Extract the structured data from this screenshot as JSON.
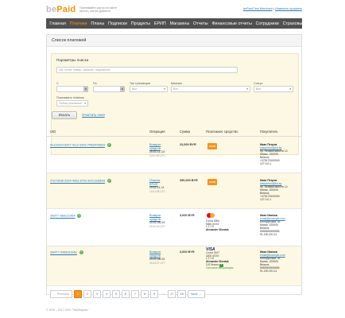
{
  "logo": {
    "be": "be",
    "paid": "Paid"
  },
  "tagline": [
    "Принимайте карты на сайте",
    "просто, как вы думаете"
  ],
  "user": {
    "merchant": "bePaid Test Merchant",
    "separator": " • ",
    "edit_profile": "Изменить профиль"
  },
  "nav": {
    "items": [
      {
        "label": "Главная",
        "active": false
      },
      {
        "label": "Платежи",
        "active": true
      },
      {
        "label": "Планы",
        "active": false
      },
      {
        "label": "Подписки",
        "active": false
      },
      {
        "label": "Продукты",
        "active": false
      },
      {
        "label": "ЕРИП",
        "active": false
      },
      {
        "label": "Магазины",
        "active": false
      },
      {
        "label": "Отчеты",
        "active": false
      },
      {
        "label": "Финансовые отчеты",
        "active": false
      },
      {
        "label": "Сотрудники",
        "active": false
      },
      {
        "label": "Страховые депозиты",
        "active": false
      }
    ]
  },
  "page": {
    "title": "Список платежей"
  },
  "filters": {
    "title": "Параметры поиска",
    "search_placeholder": "Uid, отчет, номер, магазин, покупатель",
    "from_label": "С",
    "to_label": "По",
    "type_label": "Тип транзакции",
    "shop_label": "Магазин",
    "status_label": "Статус",
    "show_label": "Показывать платежи",
    "type_value": "Все",
    "shop_value": "Все",
    "status_value": "Все",
    "show_value": "Только реальные",
    "calendar_glyph": "▦",
    "arrow_glyph": "▾",
    "search_button": "Искать",
    "clear_link": "Очистить поля"
  },
  "table": {
    "headers": {
      "uid": "UID",
      "operation": "Операция",
      "amount": "Сумма",
      "method": "Платежное средство",
      "buyer": "Покупатель"
    },
    "rows": [
      {
        "uid": "5e12e5e4-6d07-4cc2-a493-7f4b6448be5",
        "operation": [
          "Возврат",
          "средств"
        ],
        "date": "2015-11-13",
        "time": "13:02:59 UTC",
        "amount": "22,000 BYR",
        "method_type": "erip",
        "method_label": "ЕРИП",
        "buyer": [
          "Иван Петров",
          "ivanpetrov@tut.by",
          "пр. Независимости 14",
          "Минск, 220000",
          "Belarus",
          "+375172000000",
          "127.0.0.1"
        ]
      },
      {
        "uid": "47a734d6-3394-49ba-870e-9cf1c3d8b4d",
        "operation": [
          "Платеж",
          "ЕРИП"
        ],
        "date": "2015-11-11",
        "time": "13:21:08 UTC",
        "amount": "350,000 BYR",
        "method_type": "erip",
        "method_label": "ЕРИП",
        "buyer": [
          "Иван Петров",
          "ivanpetrov@tut.by",
          "пр. Независимости 14",
          "Минск, 220000",
          "Belarus",
          "+375172000000",
          "127.0.0.1"
        ]
      },
      {
        "uid": "390f77-6b6c2c964",
        "operation": [
          "Возврат",
          "средств"
        ],
        "date": "2015-06-03",
        "time": "09:44:33 UTC",
        "amount": "3,000 BYR",
        "method_type": "mastercard",
        "card": [
          "5 xxxx 5904",
          "5555 XXXX",
          "1 2 1 8"
        ],
        "holder": "Alexander Shostak",
        "buyer": [
          "Иван Иванов",
          "email@example.com",
          "Белорусская, 41",
          "Минск, 220000",
          "Belarus",
          "5555555555555",
          "91.190.201.11"
        ]
      },
      {
        "uid": "390f77-9458d19b5e",
        "operation": [
          "Возврат",
          "средств"
        ],
        "date": "2015-06-03",
        "time": "09:44:27 UTC",
        "amount": "3,000 BYR",
        "method_type": "visa",
        "method_label": "VISA",
        "card": [
          "4 xxxx 0107",
          "4200 XXXX",
          "1 2 1 8"
        ],
        "holder": "Alexander Shostak",
        "secure": "3-D Secure",
        "secure_badge": "Y",
        "secure_status": "Успешная авторизация",
        "buyer": [
          "Иван Иванов",
          "email@example.com",
          "Белорусская, 41",
          "Минск, 220000",
          "Belarus",
          "5555555555555",
          "91.190.201.11"
        ]
      }
    ]
  },
  "pagination": {
    "prev": "← Previous",
    "next": "Next →",
    "pages": [
      "1",
      "2",
      "3",
      "4",
      "5",
      "6",
      "7",
      "8",
      "9",
      "…",
      "17",
      "18"
    ],
    "active": "1"
  },
  "footer": "© 2015 – 2017 ООО \"ЭкоМатрикс\""
}
